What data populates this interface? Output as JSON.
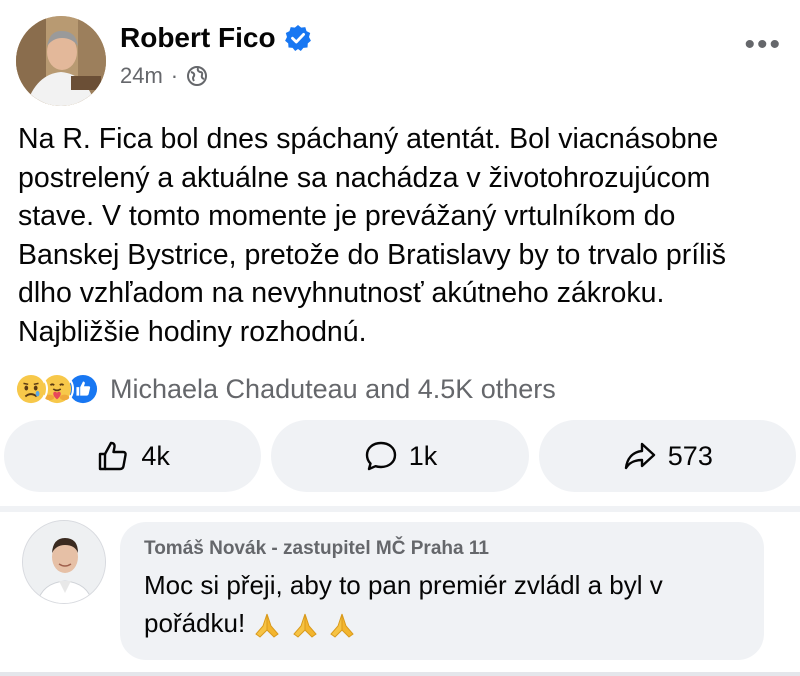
{
  "post": {
    "author": "Robert Fico",
    "time": "24m",
    "separator": "·",
    "more_label": "•••",
    "lines": [
      "Na R. Fica bol dnes spáchaný atentát. Bol viacnásobne",
      "postrelený a aktuálne sa nachádza v životohrozujúcom",
      "stave. V tomto momente je prevážaný vrtulníkom do",
      "Banskej Bystrice, pretože do Bratislavy by to trvalo príliš",
      "dlho vzhľadom na nevyhnutnosť akútneho zákroku.",
      "Najbližšie hodiny rozhodnú."
    ],
    "reactions_summary": "Michaela Chaduteau and 4.5K others",
    "reaction_icons": [
      "sad-icon",
      "care-icon",
      "like-icon"
    ],
    "actions": {
      "like_count": "4k",
      "comment_count": "1k",
      "share_count": "573"
    }
  },
  "comment": {
    "author": "Tomáš Novák - zastupitel MČ Praha 11",
    "text": "Moc si přeji, aby to pan premiér zvládl a byl v pořádku!",
    "emoji": [
      "pray-icon",
      "pray-icon",
      "pray-icon"
    ]
  },
  "colors": {
    "verified": "#1877f2",
    "muted": "#65676b",
    "surface": "#f0f2f5",
    "like_blue": "#1877f2"
  }
}
